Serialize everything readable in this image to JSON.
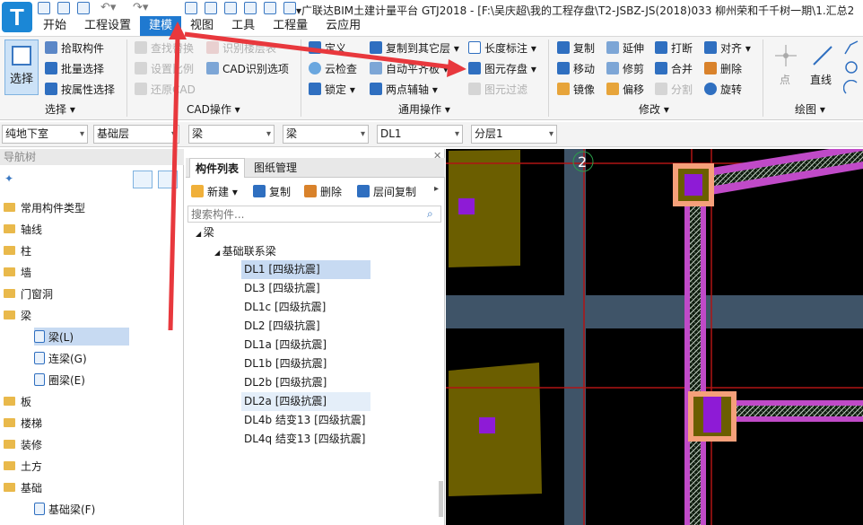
{
  "window": {
    "title": "▾广联达BIM土建计量平台 GTJ2018 - [F:\\吴庆超\\我的工程存盘\\T2-JSBZ-JS(2018)033 柳州荣和千千树一期\\1.汇总2"
  },
  "menubar": {
    "items": [
      "开始",
      "工程设置",
      "建模",
      "视图",
      "工具",
      "工程量",
      "云应用"
    ],
    "active": "建模"
  },
  "ribbon": {
    "select_group": {
      "big_button": "选择",
      "items": [
        "拾取构件",
        "批量选择",
        "按属性选择"
      ],
      "label": "选择 ▾"
    },
    "cad_group": {
      "items_disabled": [
        "查找替换",
        "识别楼层表",
        "设置比例",
        "还原CAD"
      ],
      "item_enabled": "CAD识别选项",
      "label": "CAD操作 ▾"
    },
    "common_group": {
      "col1": [
        "定义",
        "云检查",
        "锁定 ▾"
      ],
      "col2": [
        "复制到其它层 ▾",
        "自动平齐板 ▾",
        "两点辅轴 ▾"
      ],
      "col3": [
        "长度标注 ▾",
        "图元存盘 ▾",
        "图元过滤"
      ],
      "label": "通用操作 ▾"
    },
    "modify_group": {
      "col1": [
        "复制",
        "移动",
        "镜像"
      ],
      "col2": [
        "延伸",
        "修剪",
        "偏移"
      ],
      "col3": [
        "打断",
        "合并",
        "分割"
      ],
      "col4": [
        "对齐 ▾",
        "删除",
        "旋转"
      ],
      "label": "修改 ▾"
    },
    "draw_group": {
      "items": [
        "点",
        "直线"
      ],
      "label": "绘图 ▾"
    }
  },
  "toolbar": {
    "selects": [
      "纯地下室",
      "基础层",
      "梁",
      "梁",
      "DL1",
      "分层1"
    ]
  },
  "nav": {
    "header": "导航树",
    "items": [
      {
        "label": "常用构件类型",
        "type": "folder"
      },
      {
        "label": "轴线",
        "type": "folder"
      },
      {
        "label": "柱",
        "type": "folder"
      },
      {
        "label": "墙",
        "type": "folder"
      },
      {
        "label": "门窗洞",
        "type": "folder"
      },
      {
        "label": "梁",
        "type": "folder"
      },
      {
        "label": "梁(L)",
        "type": "child",
        "selected": true
      },
      {
        "label": "连梁(G)",
        "type": "child"
      },
      {
        "label": "圈梁(E)",
        "type": "child"
      },
      {
        "label": "板",
        "type": "folder"
      },
      {
        "label": "楼梯",
        "type": "folder"
      },
      {
        "label": "装修",
        "type": "folder"
      },
      {
        "label": "土方",
        "type": "folder"
      },
      {
        "label": "基础",
        "type": "folder"
      },
      {
        "label": "基础梁(F)",
        "type": "child"
      }
    ]
  },
  "component": {
    "tabs": [
      "构件列表",
      "图纸管理"
    ],
    "actions": [
      "新建 ▾",
      "复制",
      "删除",
      "层间复制"
    ],
    "search_placeholder": "搜索构件...",
    "tree_root": "梁",
    "tree_group": "基础联系梁",
    "items": [
      "DL1 [四级抗震]",
      "DL3 [四级抗震]",
      "DL1c [四级抗震]",
      "DL2 [四级抗震]",
      "DL1a [四级抗震]",
      "DL1b [四级抗震]",
      "DL2b [四级抗震]",
      "DL2a [四级抗震]",
      "DL4b 结变13 [四级抗震]",
      "DL4q 结变13 [四级抗震]"
    ]
  },
  "canvas": {
    "axis_label": "2",
    "colors": {
      "column": "#6b5e00",
      "beam": "#3f5468",
      "magenta": "#c04ac8",
      "pink": "#f5a07a",
      "purple": "#8e1bd6",
      "axis": "#b01414"
    }
  },
  "annotations": {
    "arrow_color": "#e8383d"
  }
}
